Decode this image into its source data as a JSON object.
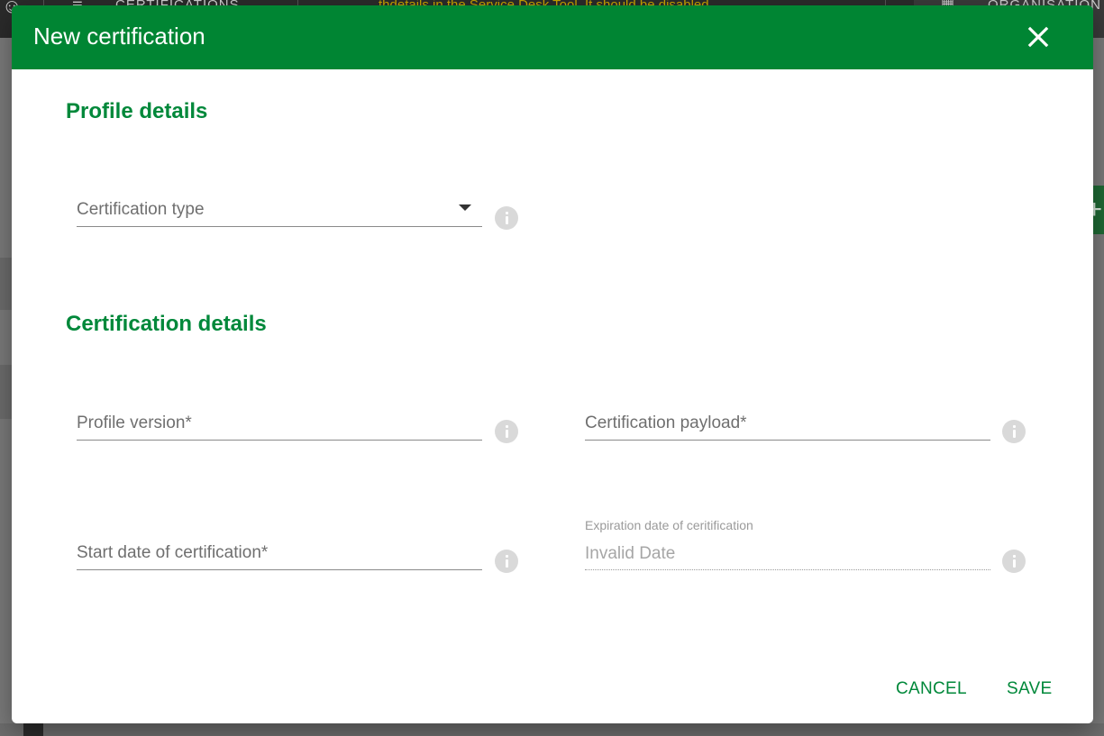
{
  "background": {
    "topbar_title": "CERTIFICATIONS",
    "banner_text": "thdetails in the Service Desk Tool. It should be disabled",
    "org_label": "ORGANISATION"
  },
  "dialog": {
    "title": "New certification",
    "close_icon": "close-icon",
    "sections": {
      "profile": "Profile details",
      "certification": "Certification details"
    },
    "fields": {
      "certification_type": {
        "label": "Certification type",
        "icon": "info-icon"
      },
      "profile_version": {
        "label": "Profile version*",
        "icon": "info-icon"
      },
      "certification_payload": {
        "label": "Certification payload*",
        "icon": "info-icon"
      },
      "start_date": {
        "label": "Start date of certification*",
        "icon": "info-icon"
      },
      "expiration_date": {
        "label": "Expiration date of ceritification",
        "value": "Invalid Date",
        "icon": "info-icon"
      }
    },
    "actions": {
      "cancel": "CANCEL",
      "save": "SAVE"
    }
  },
  "colors": {
    "header_green": "#008533",
    "accent_green": "#00883a",
    "overlay": "#7a7a7a"
  }
}
